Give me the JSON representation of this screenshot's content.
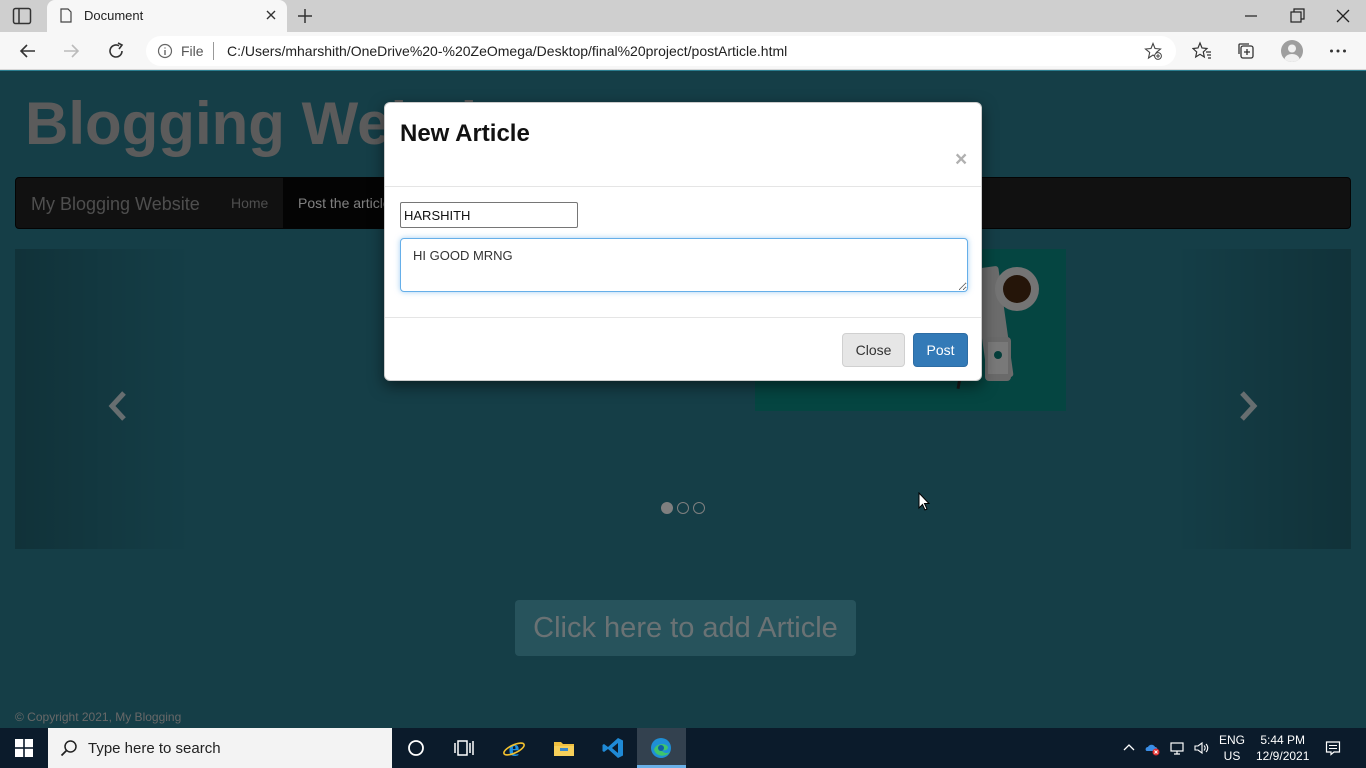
{
  "browser": {
    "tab_title": "Document",
    "url_scheme_label": "File",
    "url": "C:/Users/mharshith/OneDrive%20-%20ZeOmega/Desktop/final%20project/postArticle.html"
  },
  "site": {
    "title": "Blogging Website",
    "brand": "My Blogging Website",
    "nav_home": "Home",
    "nav_post": "Post the article",
    "add_article_button": "Click here to add Article",
    "footer": "© Copyright 2021, My Blogging"
  },
  "carousel": {
    "slide_count": 3,
    "active_index": 0
  },
  "modal": {
    "title": "New Article",
    "close_symbol": "×",
    "name_value": "HARSHITH",
    "article_value": "HI GOOD MRNG",
    "close_label": "Close",
    "post_label": "Post"
  },
  "taskbar": {
    "search_placeholder": "Type here to search",
    "lang_line1": "ENG",
    "lang_line2": "US",
    "time": "5:44 PM",
    "date": "12/9/2021"
  },
  "colors": {
    "page_bg": "#2a7d8f",
    "navbar_bg": "#222222",
    "primary_button": "#337ab7",
    "add_button": "#4fa6b8"
  }
}
